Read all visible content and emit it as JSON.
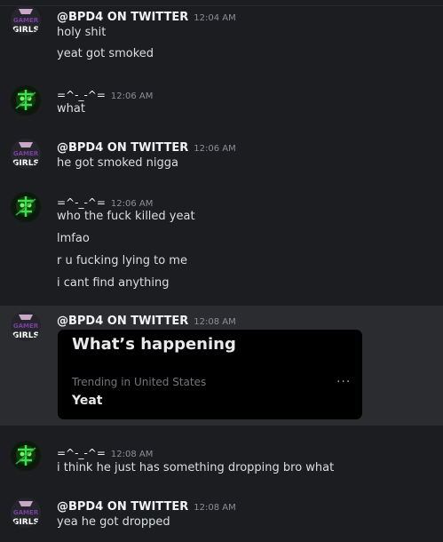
{
  "colors": {
    "background": "#1c1d21",
    "highlight_row": "#2b2c30",
    "username": "#f2f3f5",
    "message_text": "#dbdee1",
    "timestamp": "#8d8f96",
    "embed_bg": "#000000"
  },
  "messages": [
    {
      "author": "@BPD4 ON TWITTER",
      "time": "12:04 AM",
      "avatar_icon": "gamer-girls-avatar",
      "avatar_text": [
        "GAMER",
        "GIRLS"
      ],
      "lines": [
        "holy shit",
        "yeat got smoked"
      ]
    },
    {
      "author": "=^-_-^=",
      "time": "12:06 AM",
      "avatar_icon": "green-skull-avatar",
      "lines": [
        "what"
      ]
    },
    {
      "author": "@BPD4 ON TWITTER",
      "time": "12:06 AM",
      "avatar_icon": "gamer-girls-avatar",
      "avatar_text": [
        "GAMER",
        "GIRLS"
      ],
      "lines": [
        "he got smoked nigga"
      ]
    },
    {
      "author": "=^-_-^=",
      "time": "12:06 AM",
      "avatar_icon": "green-skull-avatar",
      "lines": [
        "who the fuck killed yeat",
        "lmfao",
        "r u fucking lying to me",
        "i cant find anything"
      ]
    },
    {
      "author": "@BPD4 ON TWITTER",
      "time": "12:08 AM",
      "avatar_icon": "gamer-girls-avatar",
      "avatar_text": [
        "GAMER",
        "GIRLS"
      ],
      "embed": {
        "title": "What’s happening",
        "meta": "Trending in United States",
        "topic": "Yeat",
        "more_icon": "more-horizontal-icon",
        "more_glyph": "···"
      }
    },
    {
      "author": "=^-_-^=",
      "time": "12:08 AM",
      "avatar_icon": "green-skull-avatar",
      "lines": [
        "i think he just has something dropping bro what"
      ]
    },
    {
      "author": "@BPD4 ON TWITTER",
      "time": "12:08 AM",
      "avatar_icon": "gamer-girls-avatar",
      "avatar_text": [
        "GAMER",
        "GIRLS"
      ],
      "lines": [
        "yea he got dropped"
      ]
    }
  ]
}
